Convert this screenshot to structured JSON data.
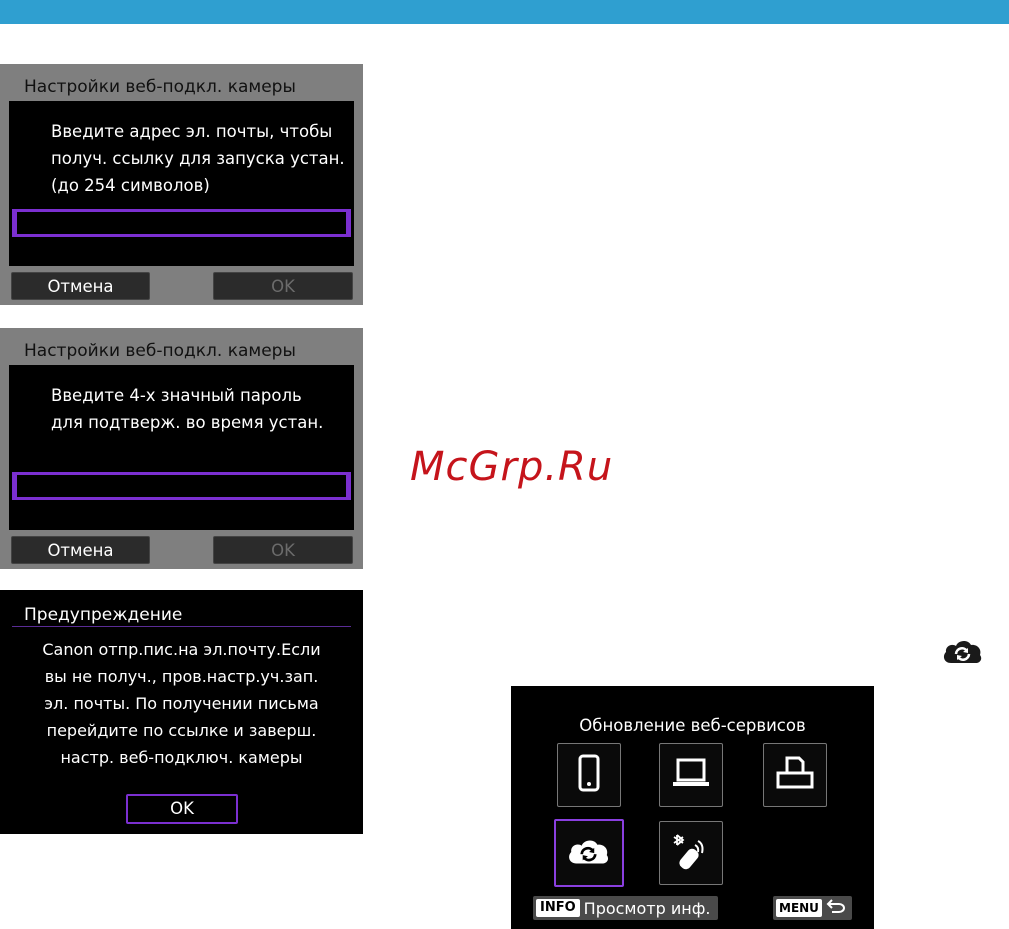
{
  "screen1": {
    "title": "Настройки веб-подкл. камеры",
    "message_lines": [
      "Введите адрес эл. почты, чтобы",
      "получ. ссылку для запуска устан.",
      "(до 254 символов)"
    ],
    "input_value": "",
    "cancel_label": "Отмена",
    "ok_label": "OK"
  },
  "screen2": {
    "title": "Настройки веб-подкл. камеры",
    "message_lines": [
      "Введите 4-х значный пароль",
      "для подтверж. во время устан."
    ],
    "input_value": "",
    "cancel_label": "Отмена",
    "ok_label": "OK"
  },
  "screen3": {
    "title": "Предупреждение",
    "message_lines": [
      "Canon отпр.пис.на эл.почту.Если",
      "вы не получ., пров.настр.уч.зап.",
      "эл. почты. По получении письма",
      "перейдите по ссылке и заверш.",
      "настр. веб-подключ. камеры"
    ],
    "ok_label": "OK"
  },
  "watermark": "McGrp.Ru",
  "services_screen": {
    "title": "Обновление веб-сервисов",
    "tiles": [
      {
        "icon": "smartphone-icon"
      },
      {
        "icon": "computer-icon"
      },
      {
        "icon": "printer-icon"
      },
      {
        "icon": "web-service-cloud-icon",
        "selected": true
      },
      {
        "icon": "bluetooth-remote-icon"
      }
    ],
    "info_key": "INFO",
    "info_label": "Просмотр инф.",
    "menu_key": "MENU"
  },
  "colors": {
    "top_bar": "#2f9fd0",
    "accent_purple": "#7b2fd0",
    "watermark_red": "#c5141b"
  }
}
